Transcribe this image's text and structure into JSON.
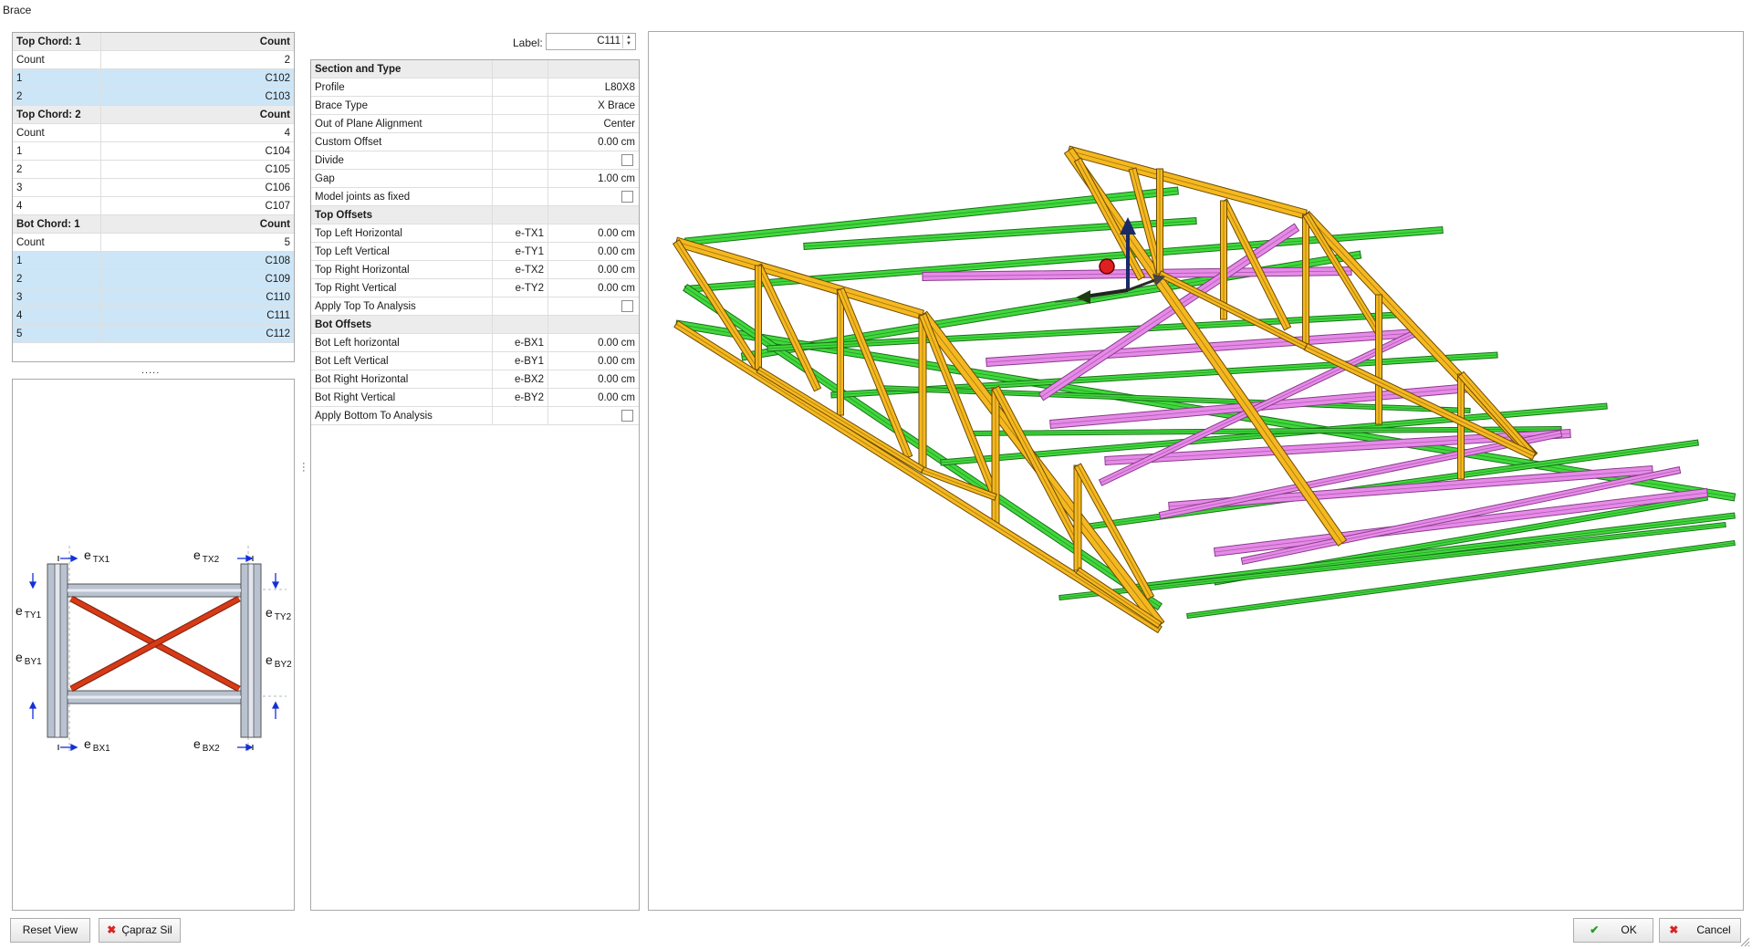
{
  "window": {
    "title": "Brace"
  },
  "chord_list": {
    "groups": [
      {
        "name": "Top Chord: 1",
        "count_header": "Count",
        "count_label": "Count",
        "count_value": "2",
        "rows": [
          {
            "index": "1",
            "value": "C102",
            "selected": true
          },
          {
            "index": "2",
            "value": "C103",
            "selected": true
          }
        ]
      },
      {
        "name": "Top Chord: 2",
        "count_header": "Count",
        "count_label": "Count",
        "count_value": "4",
        "rows": [
          {
            "index": "1",
            "value": "C104",
            "selected": false
          },
          {
            "index": "2",
            "value": "C105",
            "selected": false
          },
          {
            "index": "3",
            "value": "C106",
            "selected": false
          },
          {
            "index": "4",
            "value": "C107",
            "selected": false
          }
        ]
      },
      {
        "name": "Bot Chord: 1",
        "count_header": "Count",
        "count_label": "Count",
        "count_value": "5",
        "rows": [
          {
            "index": "1",
            "value": "C108",
            "selected": true
          },
          {
            "index": "2",
            "value": "C109",
            "selected": true
          },
          {
            "index": "3",
            "value": "C110",
            "selected": true
          },
          {
            "index": "4",
            "value": "C111",
            "selected": true
          },
          {
            "index": "5",
            "value": "C112",
            "selected": true
          }
        ]
      }
    ]
  },
  "splitter": {
    "horizontal_grip": ".....",
    "vertical_grip": "⋮"
  },
  "diagram": {
    "labels": {
      "tx1": {
        "main": "e",
        "sub": "TX1"
      },
      "tx2": {
        "main": "e",
        "sub": "TX2"
      },
      "ty1": {
        "main": "e",
        "sub": "TY1"
      },
      "ty2": {
        "main": "e",
        "sub": "TY2"
      },
      "by1": {
        "main": "e",
        "sub": "BY1"
      },
      "by2": {
        "main": "e",
        "sub": "BY2"
      },
      "bx1": {
        "main": "e",
        "sub": "BX1"
      },
      "bx2": {
        "main": "e",
        "sub": "BX2"
      }
    },
    "colors": {
      "column": "#b9c2d0",
      "brace": "#d63a16",
      "arrow": "#1530d8"
    }
  },
  "label_field": {
    "caption": "Label:",
    "value": "C111"
  },
  "properties": [
    {
      "type": "category",
      "name": "Section and Type"
    },
    {
      "type": "row",
      "name": "Profile",
      "code": "",
      "value": "L80X8"
    },
    {
      "type": "row",
      "name": "Brace Type",
      "code": "",
      "value": "X Brace"
    },
    {
      "type": "row",
      "name": "Out of Plane Alignment",
      "code": "",
      "value": "Center"
    },
    {
      "type": "row",
      "name": "Custom Offset",
      "code": "",
      "value": "0.00 cm"
    },
    {
      "type": "check",
      "name": "Divide",
      "code": "",
      "checked": false
    },
    {
      "type": "row",
      "name": "Gap",
      "code": "",
      "value": "1.00 cm"
    },
    {
      "type": "check",
      "name": "Model joints as fixed",
      "code": "",
      "checked": false
    },
    {
      "type": "category",
      "name": "Top Offsets"
    },
    {
      "type": "row",
      "name": "Top Left Horizontal",
      "code": "e-TX1",
      "value": "0.00 cm"
    },
    {
      "type": "row",
      "name": "Top Left Vertical",
      "code": "e-TY1",
      "value": "0.00 cm"
    },
    {
      "type": "row",
      "name": "Top Right Horizontal",
      "code": "e-TX2",
      "value": "0.00 cm"
    },
    {
      "type": "row",
      "name": "Top Right Vertical",
      "code": "e-TY2",
      "value": "0.00 cm"
    },
    {
      "type": "check",
      "name": "Apply Top To Analysis",
      "code": "",
      "checked": false
    },
    {
      "type": "category",
      "name": "Bot Offsets"
    },
    {
      "type": "row",
      "name": "Bot Left horizontal",
      "code": "e-BX1",
      "value": "0.00 cm"
    },
    {
      "type": "row",
      "name": "Bot Left Vertical",
      "code": "e-BY1",
      "value": "0.00 cm"
    },
    {
      "type": "row",
      "name": "Bot Right Horizontal",
      "code": "e-BX2",
      "value": "0.00 cm"
    },
    {
      "type": "row",
      "name": "Bot Right Vertical",
      "code": "e-BY2",
      "value": "0.00 cm"
    },
    {
      "type": "check",
      "name": "Apply Bottom To Analysis",
      "code": "",
      "checked": false
    }
  ],
  "viewport": {
    "colors": {
      "truss": "#f5b820",
      "truss_edge": "#6b4a00",
      "purlin_green": "#3fd93c",
      "green_edge": "#1c6e1a",
      "brace_pink": "#e68ae8",
      "pink_edge": "#8a3b8c"
    },
    "gizmo": {
      "axis_z": "#1a2a66",
      "origin": "#e02020"
    }
  },
  "buttons": {
    "reset_view": "Reset View",
    "delete_brace": "Çapraz Sil",
    "ok": "OK",
    "cancel": "Cancel"
  },
  "icons": {
    "delete": "✖",
    "ok": "✔",
    "cancel": "✖"
  }
}
